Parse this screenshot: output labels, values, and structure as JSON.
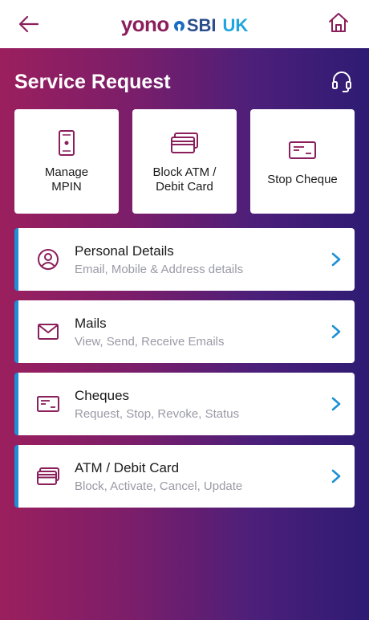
{
  "header": {
    "logo": {
      "yono": "yono",
      "sbi": "SBI",
      "uk": "UK"
    }
  },
  "page": {
    "title": "Service Request"
  },
  "tiles": [
    {
      "label": "Manage\nMPIN",
      "icon": "phone-icon"
    },
    {
      "label": "Block ATM /\nDebit Card",
      "icon": "cards-icon"
    },
    {
      "label": "Stop Cheque",
      "icon": "cheque-icon"
    }
  ],
  "list": [
    {
      "title": "Personal Details",
      "subtitle": "Email, Mobile & Address details",
      "icon": "user-icon"
    },
    {
      "title": "Mails",
      "subtitle": "View, Send, Receive Emails",
      "icon": "mail-icon"
    },
    {
      "title": "Cheques",
      "subtitle": "Request, Stop, Revoke, Status",
      "icon": "cheque-icon"
    },
    {
      "title": "ATM / Debit Card",
      "subtitle": "Block, Activate, Cancel, Update",
      "icon": "cards-icon"
    }
  ],
  "colors": {
    "brand_magenta": "#8a1f5b",
    "accent_blue": "#1f8fd6",
    "icon_color": "#8a1f5b"
  }
}
